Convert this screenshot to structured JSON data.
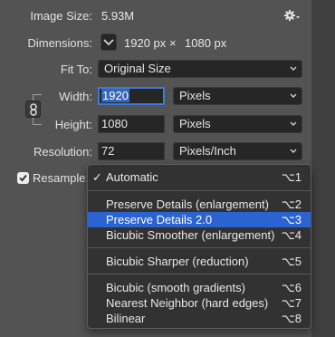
{
  "image_size": {
    "label": "Image Size:",
    "value": "5.93M"
  },
  "settings_icon": "gear-icon",
  "dimensions": {
    "label": "Dimensions:",
    "width": "1920 px",
    "times": "×",
    "height": "1080 px"
  },
  "fit_to": {
    "label": "Fit To:",
    "selected": "Original Size"
  },
  "width": {
    "label": "Width:",
    "value": "1920",
    "unit": "Pixels"
  },
  "height": {
    "label": "Height:",
    "value": "1080",
    "unit": "Pixels"
  },
  "resolution": {
    "label": "Resolution:",
    "value": "72",
    "unit": "Pixels/Inch"
  },
  "resample": {
    "label": "Resample:",
    "checked": true
  },
  "menu": {
    "items": [
      {
        "label": "Automatic",
        "shortcut": "⌥1",
        "checked": true
      },
      {
        "label": "Preserve Details (enlargement)",
        "shortcut": "⌥2"
      },
      {
        "label": "Preserve Details 2.0",
        "shortcut": "⌥3",
        "highlighted": true
      },
      {
        "label": "Bicubic Smoother (enlargement)",
        "shortcut": "⌥4"
      },
      {
        "label": "Bicubic Sharper (reduction)",
        "shortcut": "⌥5"
      },
      {
        "label": "Bicubic (smooth gradients)",
        "shortcut": "⌥6"
      },
      {
        "label": "Nearest Neighbor (hard edges)",
        "shortcut": "⌥7"
      },
      {
        "label": "Bilinear",
        "shortcut": "⌥8"
      }
    ]
  },
  "colors": {
    "panel_bg": "#535353",
    "field_bg": "#262626",
    "menu_bg": "#323232",
    "highlight": "#2b63d0",
    "focus_ring": "#3d7ad6"
  }
}
